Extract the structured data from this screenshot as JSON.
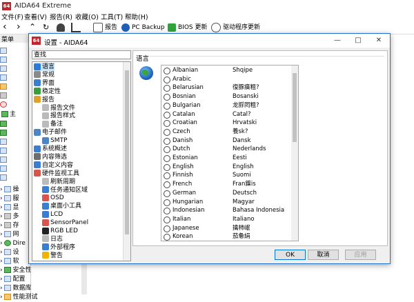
{
  "app": {
    "title": "AIDA64 Extreme",
    "logo": "64"
  },
  "menu": [
    "文件(F)",
    "查看(V)",
    "报告(R)",
    "收藏(O)",
    "工具(T)",
    "帮助(H)"
  ],
  "toolbar": {
    "report": "报告",
    "pc_backup": "PC Backup",
    "bios": "BIOS 更新",
    "driver": "驱动程序更新"
  },
  "leftpane": {
    "header": "菜单",
    "items": [
      "主",
      "操",
      "服",
      "显",
      "多",
      "存",
      "网",
      "Dire",
      "设",
      "软",
      "安全性",
      "配置",
      "数据库",
      "性能测试"
    ]
  },
  "dialog": {
    "title": "设置 - AIDA64",
    "search_placeholder": "查找",
    "tree": [
      {
        "label": "语言",
        "icon": "globe-icon",
        "color": "#2b7bd6"
      },
      {
        "label": "常规",
        "icon": "gear-icon",
        "color": "#8a8a8a"
      },
      {
        "label": "界面",
        "icon": "window-icon",
        "color": "#3a7ed1"
      },
      {
        "label": "稳定性",
        "icon": "shield-icon",
        "color": "#3a9e3a"
      },
      {
        "label": "报告",
        "icon": "report-icon",
        "color": "#e0a02a"
      },
      {
        "label": "报告文件",
        "icon": "file-icon",
        "color": "#bbbbbb"
      },
      {
        "label": "报告样式",
        "icon": "style-icon",
        "color": "#bbbbbb"
      },
      {
        "label": "备注",
        "icon": "note-icon",
        "color": "#bbbbbb"
      },
      {
        "label": "电子邮件",
        "icon": "email-icon",
        "color": "#4a86c7"
      },
      {
        "label": "SMTP",
        "icon": "smtp-icon",
        "color": "#4a86c7"
      },
      {
        "label": "系统概述",
        "icon": "monitor-icon",
        "color": "#3a7ed1"
      },
      {
        "label": "内容筛选",
        "icon": "filter-icon",
        "color": "#6d6d6d"
      },
      {
        "label": "自定义内容",
        "icon": "custom-icon",
        "color": "#3a7ed1"
      },
      {
        "label": "硬件监视工具",
        "icon": "monitor-tool-icon",
        "color": "#d9534f"
      },
      {
        "label": "刷新周期",
        "icon": "refresh-icon",
        "color": "#bbbbbb"
      },
      {
        "label": "任务通知区域",
        "icon": "tray-icon",
        "color": "#3a7ed1"
      },
      {
        "label": "OSD",
        "icon": "osd-icon",
        "color": "#d9534f"
      },
      {
        "label": "桌面小工具",
        "icon": "gadget-icon",
        "color": "#3a7ed1"
      },
      {
        "label": "LCD",
        "icon": "lcd-icon",
        "color": "#3a7ed1"
      },
      {
        "label": "SensorPanel",
        "icon": "sensor-icon",
        "color": "#d9534f"
      },
      {
        "label": "RGB LED",
        "icon": "rgb-icon",
        "color": "#222222"
      },
      {
        "label": "日志",
        "icon": "log-icon",
        "color": "#bbbbbb"
      },
      {
        "label": "外部程序",
        "icon": "external-icon",
        "color": "#3a7ed1"
      },
      {
        "label": "警告",
        "icon": "warning-icon",
        "color": "#f0b400"
      }
    ],
    "panel_header": "语言",
    "languages": [
      {
        "name": "Albanian",
        "native": "Shqipe"
      },
      {
        "name": "Arabic",
        "native": ""
      },
      {
        "name": "Belarusian",
        "native": "復豚癀粗?"
      },
      {
        "name": "Bosnian",
        "native": "Bosanski"
      },
      {
        "name": "Bulgarian",
        "native": "龙脬罔粗?"
      },
      {
        "name": "Catalan",
        "native": "Catal?"
      },
      {
        "name": "Croatian",
        "native": "Hrvatski"
      },
      {
        "name": "Czech",
        "native": "養sk?"
      },
      {
        "name": "Danish",
        "native": "Dansk"
      },
      {
        "name": "Dutch",
        "native": "Nederlands"
      },
      {
        "name": "Estonian",
        "native": "Eesti"
      },
      {
        "name": "English",
        "native": "English"
      },
      {
        "name": "Finnish",
        "native": "Suomi"
      },
      {
        "name": "French",
        "native": "Fran鐷is"
      },
      {
        "name": "German",
        "native": "Deutsch"
      },
      {
        "name": "Hungarian",
        "native": "Magyar"
      },
      {
        "name": "Indonesian",
        "native": "Bahasa Indonesia"
      },
      {
        "name": "Italian",
        "native": "Italiano"
      },
      {
        "name": "Japanese",
        "native": "擒柿岷"
      },
      {
        "name": "Korean",
        "native": "茄惫绢"
      }
    ],
    "buttons": {
      "ok": "OK",
      "cancel": "取消",
      "apply": "应用"
    }
  }
}
